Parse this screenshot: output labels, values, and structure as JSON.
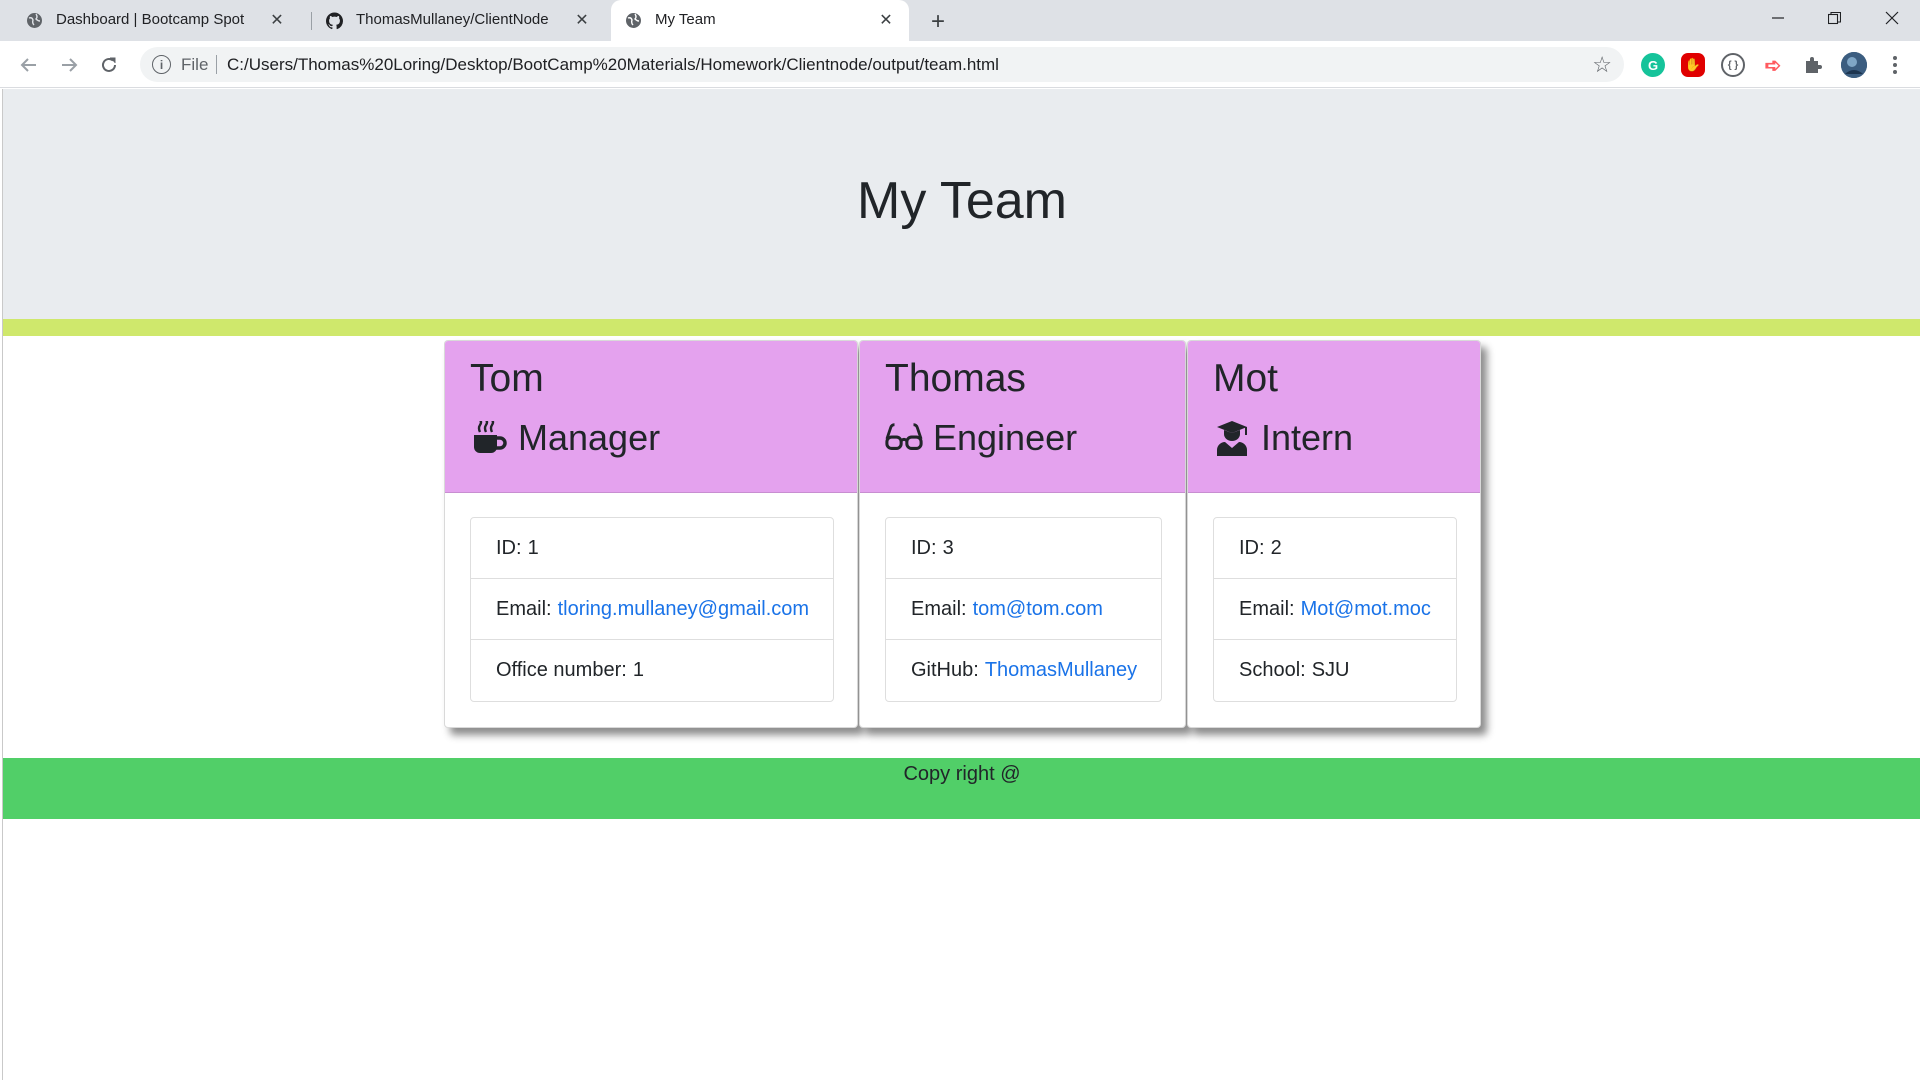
{
  "browser": {
    "tabs": [
      {
        "title": "Dashboard | Bootcamp Spot",
        "icon": "globe-icon"
      },
      {
        "title": "ThomasMullaney/ClientNode",
        "icon": "github-icon"
      },
      {
        "title": "My Team",
        "icon": "globe-icon",
        "active": true
      }
    ],
    "new_tab_label": "+",
    "address": {
      "scheme_label": "File",
      "url": "C:/Users/Thomas%20Loring/Desktop/BootCamp%20Materials/Homework/Clientnode/output/team.html"
    },
    "extensions": [
      "grammarly-icon",
      "adblock-icon",
      "extension-icon",
      "cast-icon",
      "puzzle-icon",
      "profile-avatar-icon"
    ]
  },
  "page": {
    "title": "My Team",
    "colors": {
      "jumbotron": "#e9ecef",
      "accent_bar": "#cfe86c",
      "card_header": "#e4a2ee",
      "footer": "#51cf68",
      "link": "#1a73e8"
    },
    "cards": [
      {
        "name": "Tom",
        "role": "Manager",
        "role_icon": "coffee-mug-icon",
        "id_label": "ID:",
        "id": "1",
        "email_label": "Email:",
        "email": "tloring.mullaney@gmail.com",
        "extra_label": "Office number:",
        "extra": "1"
      },
      {
        "name": "Thomas",
        "role": "Engineer",
        "role_icon": "glasses-icon",
        "id_label": "ID:",
        "id": "3",
        "email_label": "Email:",
        "email": "tom@tom.com",
        "extra_label": "GitHub:",
        "extra": "ThomasMullaney"
      },
      {
        "name": "Mot",
        "role": "Intern",
        "role_icon": "graduate-icon",
        "id_label": "ID:",
        "id": "2",
        "email_label": "Email:",
        "email": "Mot@mot.moc",
        "extra_label": "School:",
        "extra": "SJU"
      }
    ],
    "footer": "Copy right @"
  }
}
